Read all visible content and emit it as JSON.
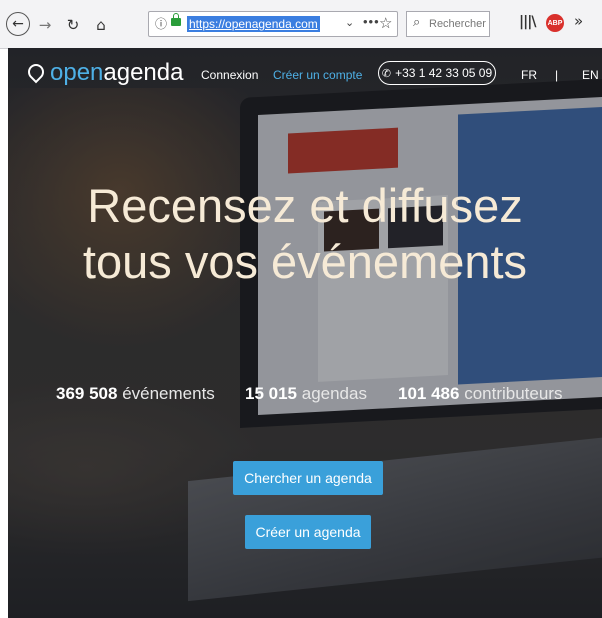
{
  "browser": {
    "url": "https://openagenda.com",
    "search_placeholder": "Rechercher",
    "more_label": "»",
    "info_label": "ⓘ",
    "dots": "•••"
  },
  "site": {
    "logo_open": "open",
    "logo_agenda": "agenda",
    "nav": {
      "login": "Connexion",
      "signup": "Créer un compte",
      "phone": "+33 1 42 33 05 09",
      "lang_fr": "FR",
      "lang_sep": "|",
      "lang_en": "EN"
    },
    "headline_line1": "Recensez et diffusez",
    "headline_line2": "tous vos événements",
    "stats": [
      {
        "value": "369 508",
        "label": "événements"
      },
      {
        "value": "15 015",
        "label": "agendas"
      },
      {
        "value": "101 486",
        "label": "contributeurs"
      }
    ],
    "buttons": {
      "search_agenda": "Chercher un agenda",
      "create_agenda": "Créer un agenda"
    }
  },
  "colors": {
    "accent": "#3aa0da",
    "logo_blue": "#4eb0e6",
    "headline": "#f6ead6"
  }
}
